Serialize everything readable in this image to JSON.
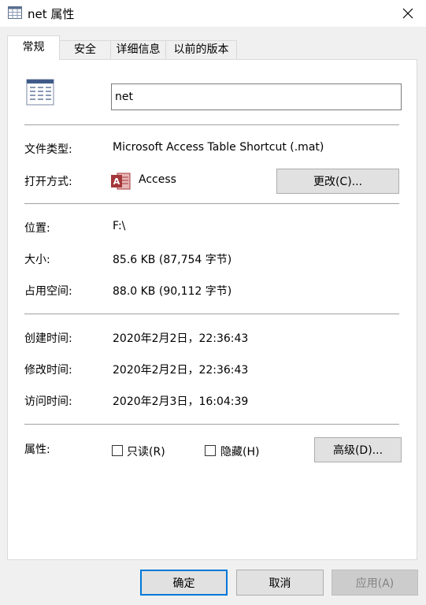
{
  "window": {
    "title": "net 属性",
    "icon": "table-shortcut-icon"
  },
  "tabs": [
    {
      "label": "常规",
      "active": true
    },
    {
      "label": "安全",
      "active": false
    },
    {
      "label": "详细信息",
      "active": false
    },
    {
      "label": "以前的版本",
      "active": false
    }
  ],
  "general": {
    "file_name": "net",
    "file_type_label": "文件类型:",
    "file_type_value": "Microsoft Access Table Shortcut (.mat)",
    "opens_with_label": "打开方式:",
    "opens_with_app": "Access",
    "change_button": "更改(C)...",
    "location_label": "位置:",
    "location_value": "F:\\",
    "size_label": "大小:",
    "size_value": "85.6 KB (87,754 字节)",
    "size_on_disk_label": "占用空间:",
    "size_on_disk_value": "88.0 KB (90,112 字节)",
    "created_label": "创建时间:",
    "created_value": "2020年2月2日，22:36:43",
    "modified_label": "修改时间:",
    "modified_value": "2020年2月2日，22:36:43",
    "accessed_label": "访问时间:",
    "accessed_value": "2020年2月3日，16:04:39",
    "attributes_label": "属性:",
    "readonly_label": "只读(R)",
    "readonly_checked": false,
    "hidden_label": "隐藏(H)",
    "hidden_checked": false,
    "advanced_button": "高级(D)..."
  },
  "footer": {
    "ok": "确定",
    "cancel": "取消",
    "apply": "应用(A)"
  },
  "colors": {
    "access_red": "#a4373a",
    "focus_blue": "#0078d7"
  }
}
